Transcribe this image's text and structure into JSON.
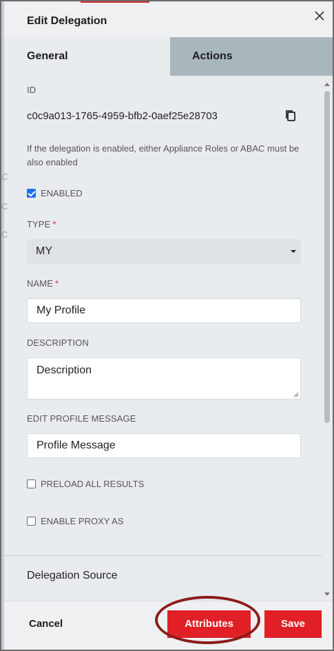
{
  "dialog": {
    "title": "Edit Delegation"
  },
  "tabs": [
    {
      "label": "General",
      "active": true
    },
    {
      "label": "Actions",
      "active": false
    }
  ],
  "fields": {
    "id_label": "ID",
    "id_value": "c0c9a013-1765-4959-bfb2-0aef25e28703",
    "hint": "If the delegation is enabled, either Appliance Roles or ABAC must be also enabled",
    "enabled_label": "ENABLED",
    "enabled_checked": true,
    "type_label": "TYPE",
    "type_value": "MY",
    "name_label": "NAME",
    "name_value": "My Profile",
    "description_label": "DESCRIPTION",
    "description_value": "Description",
    "edit_profile_message_label": "EDIT PROFILE MESSAGE",
    "edit_profile_message_value": "Profile Message",
    "preload_label": "PRELOAD ALL RESULTS",
    "preload_checked": false,
    "proxy_label": "ENABLE PROXY AS",
    "proxy_checked": false,
    "required_mark": "*"
  },
  "section": {
    "delegation_source": "Delegation Source"
  },
  "footer": {
    "cancel_label": "Cancel",
    "attributes_label": "Attributes",
    "save_label": "Save"
  },
  "background": {
    "partial_glyph": "C"
  },
  "colors": {
    "accent_red": "#e01f26",
    "highlight_ring": "#8b1d1d",
    "inactive_tab": "#a9b6bb",
    "checkbox_blue": "#1a73e8"
  },
  "icons": [
    "close-icon",
    "copy-icon",
    "chevron-down-icon",
    "resize-handle-icon"
  ]
}
